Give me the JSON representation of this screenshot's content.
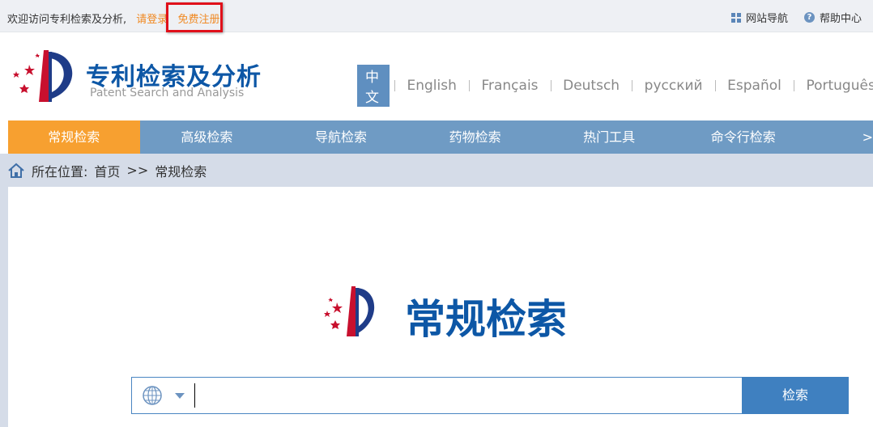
{
  "topbar": {
    "welcome": "欢迎访问专利检索及分析,",
    "login": "请登录",
    "register": "免费注册",
    "site_nav": "网站导航",
    "help": "帮助中心"
  },
  "brand": {
    "title": "专利检索及分析",
    "subtitle": "Patent Search and Analysis"
  },
  "languages": [
    {
      "label": "中文",
      "active": true
    },
    {
      "label": "English"
    },
    {
      "label": "Français"
    },
    {
      "label": "Deutsch"
    },
    {
      "label": "русский"
    },
    {
      "label": "Español"
    },
    {
      "label": "Português"
    }
  ],
  "nav": {
    "items": [
      "常规检索",
      "高级检索",
      "导航检索",
      "药物检索",
      "热门工具",
      "命令行检索"
    ],
    "more": ">",
    "active_index": 0
  },
  "breadcrumb": {
    "prefix": "所在位置:",
    "home": "首页",
    "sep": ">>",
    "current": "常规检索"
  },
  "main": {
    "title": "常规检索",
    "search_value": "",
    "search_button": "检索"
  },
  "colors": {
    "accent": "#f7a030",
    "nav": "#6f9bc4",
    "brand": "#0d57a6",
    "highlight": "#e0101a"
  }
}
